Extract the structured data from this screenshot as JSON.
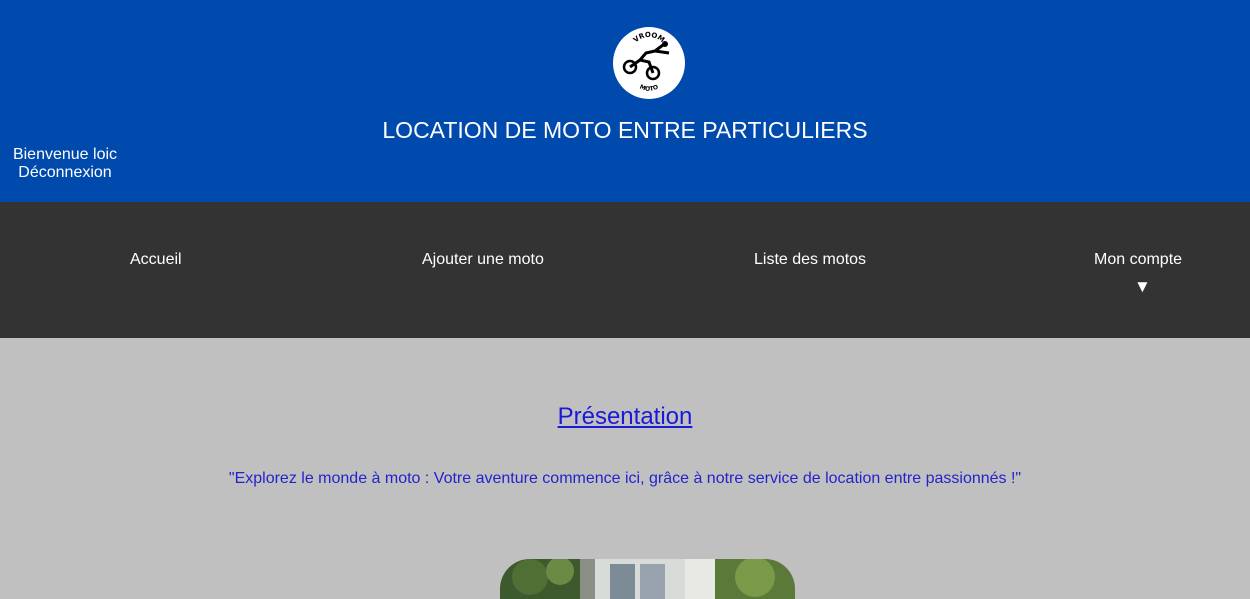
{
  "header": {
    "logo_top": "VROOM",
    "logo_bottom": "MOTO",
    "title": "LOCATION DE MOTO ENTRE PARTICULIERS",
    "welcome": "Bienvenue loic",
    "logout": "Déconnexion",
    "background": "#004aad"
  },
  "nav": {
    "items": [
      {
        "label": "Accueil"
      },
      {
        "label": "Ajouter une moto"
      },
      {
        "label": "Liste des motos"
      },
      {
        "label": "Mon compte"
      }
    ],
    "caret": "▼",
    "background": "#333333"
  },
  "main": {
    "title": "Présentation",
    "quote": "\"Explorez le monde à moto : Votre aventure commence ici, grâce à notre service de location entre passionnés !\"",
    "background": "#c0c0c0"
  }
}
